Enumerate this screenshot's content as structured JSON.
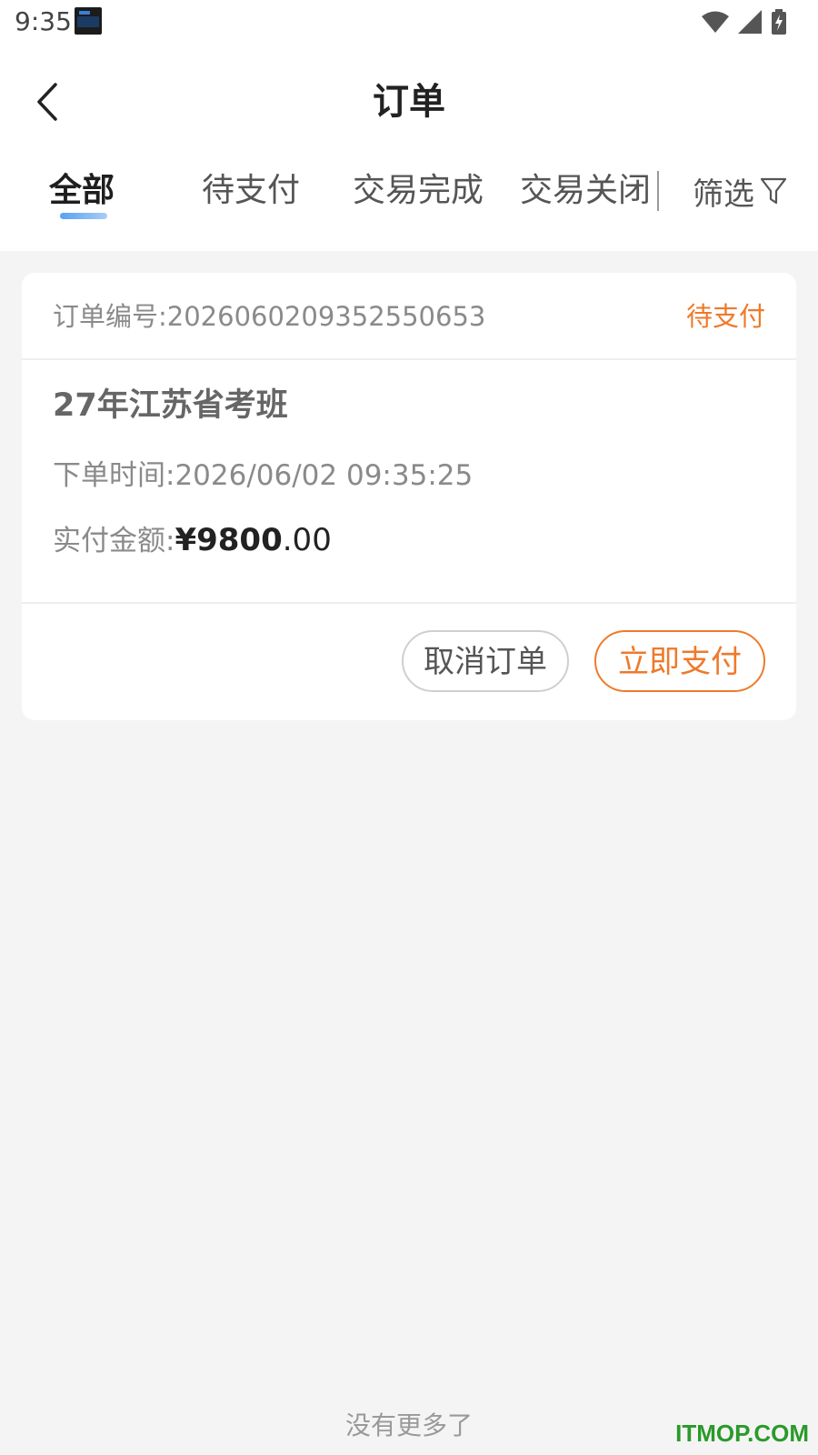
{
  "status_bar": {
    "time": "9:35",
    "icons": [
      "wifi-icon",
      "signal-icon",
      "battery-charging-icon"
    ]
  },
  "header": {
    "title": "订单"
  },
  "tabs": [
    {
      "label": "全部",
      "active": true
    },
    {
      "label": "待支付",
      "active": false
    },
    {
      "label": "交易完成",
      "active": false
    },
    {
      "label": "交易关闭",
      "active": false
    }
  ],
  "filter": {
    "label": "筛选",
    "icon": "filter-icon"
  },
  "order": {
    "number_label": "订单编号:",
    "number": "2026060209352550653",
    "status": "待支付",
    "course_name": "27年江苏省考班",
    "time_label": "下单时间:",
    "time": "2026/06/02 09:35:25",
    "amount_label": "实付金额:",
    "amount_integer": "¥9800",
    "amount_decimal": ".00",
    "cancel_label": "取消订单",
    "pay_label": "立即支付"
  },
  "footer": {
    "no_more": "没有更多了"
  },
  "watermark": "ITMOP.COM",
  "colors": {
    "accent": "#ee7a2b",
    "tab_indicator": "#5aa0f0",
    "background": "#f4f4f4"
  }
}
